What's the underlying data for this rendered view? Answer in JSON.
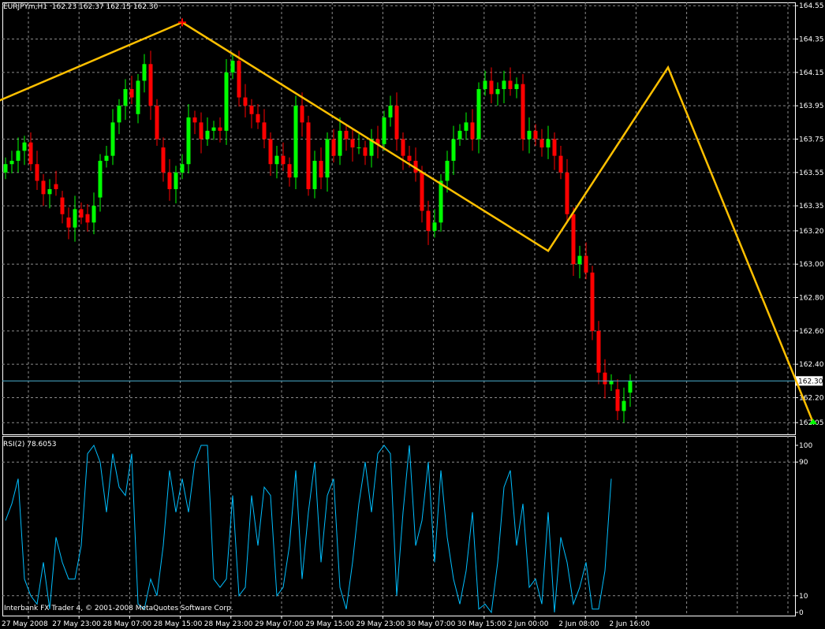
{
  "header": {
    "symbol": "EURJPYm,H1",
    "ohlc": "162.23 162.37 162.15 162.30"
  },
  "footer": "Interbank FX Trader 4, © 2001-2008 MetaQuotes Software Corp.",
  "colors": {
    "background": "#000000",
    "bull": "#00ff00",
    "bear": "#ff0000",
    "grid": "#8c8c8c",
    "zigzag": "#ffc000",
    "rsi": "#00bfff",
    "frame": "#ffffff",
    "price_line": "#4ab0d0"
  },
  "icons": {
    "zigzag_high_marker": "red-cross-icon",
    "zigzag_low_marker": "green-arrow-icon"
  },
  "chart_data": [
    {
      "type": "candlestick",
      "title": "EURJPYm,H1  162.23 162.37 162.15 162.30",
      "ylim": [
        161.98,
        164.57
      ],
      "yticks": [
        "164.55",
        "164.35",
        "164.15",
        "163.95",
        "163.75",
        "163.55",
        "163.35",
        "163.20",
        "163.00",
        "162.80",
        "162.60",
        "162.40",
        "162.20",
        "162.05"
      ],
      "xticks": [
        "27 May 2008",
        "27 May 23:00",
        "28 May 07:00",
        "28 May 15:00",
        "28 May 23:00",
        "29 May 07:00",
        "29 May 15:00",
        "29 May 23:00",
        "30 May 07:00",
        "30 May 15:00",
        "2 Jun 00:00",
        "2 Jun 08:00",
        "2 Jun 16:00"
      ],
      "current_price": "162.30",
      "closes": [
        163.6,
        163.62,
        163.68,
        163.73,
        163.6,
        163.5,
        163.42,
        163.45,
        163.45,
        163.3,
        163.22,
        163.33,
        163.28,
        163.25,
        163.35,
        163.62,
        163.65,
        163.85,
        163.95,
        164.05,
        164.0,
        164.1,
        164.2,
        163.95,
        163.75,
        163.55,
        163.45,
        163.55,
        163.6,
        163.88,
        163.85,
        163.75,
        163.8,
        163.82,
        163.8,
        164.15,
        164.22,
        164.0,
        163.95,
        163.9,
        163.85,
        163.75,
        163.6,
        163.65,
        163.6,
        163.52,
        163.95,
        163.85,
        163.45,
        163.62,
        163.52,
        163.75,
        163.65,
        163.8,
        163.75,
        163.7,
        163.7,
        163.65,
        163.75,
        163.72,
        163.88,
        163.95,
        163.75,
        163.65,
        163.62,
        163.55,
        163.32,
        163.2,
        163.25,
        163.5,
        163.62,
        163.75,
        163.8,
        163.85,
        163.75,
        164.05,
        164.1,
        164.02,
        164.05,
        164.1,
        164.05,
        164.08,
        163.75,
        163.8,
        163.75,
        163.7,
        163.75,
        163.65,
        163.55,
        163.3,
        163.0,
        163.05,
        162.95,
        162.6,
        162.35,
        162.28,
        162.3,
        162.12,
        162.18,
        162.3
      ],
      "opens": [
        163.55,
        163.6,
        163.62,
        163.68,
        163.73,
        163.6,
        163.5,
        163.42,
        163.48,
        163.4,
        163.28,
        163.22,
        163.33,
        163.3,
        163.25,
        163.4,
        163.62,
        163.65,
        163.85,
        163.95,
        164.05,
        163.9,
        164.1,
        164.2,
        163.95,
        163.7,
        163.55,
        163.45,
        163.55,
        163.6,
        163.88,
        163.85,
        163.75,
        163.8,
        163.82,
        163.8,
        164.15,
        164.22,
        164.0,
        163.95,
        163.9,
        163.85,
        163.75,
        163.6,
        163.65,
        163.6,
        163.52,
        163.95,
        163.85,
        163.45,
        163.62,
        163.52,
        163.75,
        163.65,
        163.8,
        163.75,
        163.7,
        163.7,
        163.65,
        163.75,
        163.72,
        163.88,
        163.95,
        163.75,
        163.65,
        163.62,
        163.55,
        163.32,
        163.2,
        163.25,
        163.5,
        163.62,
        163.75,
        163.8,
        163.85,
        163.75,
        164.05,
        164.1,
        164.02,
        164.05,
        164.1,
        164.05,
        164.08,
        163.75,
        163.8,
        163.75,
        163.7,
        163.75,
        163.65,
        163.55,
        163.3,
        163.0,
        163.05,
        162.95,
        162.6,
        162.35,
        162.28,
        162.25,
        162.12,
        162.23
      ],
      "zigzag": [
        {
          "x": -6,
          "y": 163.9
        },
        {
          "x": 28,
          "y": 164.45
        },
        {
          "x": 86,
          "y": 163.08
        },
        {
          "x": 105,
          "y": 164.18
        },
        {
          "x": 128,
          "y": 162.05
        }
      ]
    },
    {
      "type": "line",
      "title": "RSI(2) 78.6053",
      "ylim": [
        0,
        100
      ],
      "yticks": [
        "100",
        "90",
        "10",
        "0"
      ],
      "values": [
        55,
        65,
        80,
        20,
        10,
        5,
        30,
        2,
        45,
        30,
        20,
        20,
        40,
        95,
        100,
        90,
        60,
        95,
        75,
        70,
        95,
        5,
        2,
        20,
        10,
        40,
        85,
        60,
        80,
        60,
        90,
        100,
        100,
        20,
        15,
        20,
        70,
        10,
        15,
        70,
        40,
        75,
        70,
        10,
        15,
        40,
        85,
        20,
        60,
        90,
        30,
        70,
        80,
        15,
        2,
        30,
        65,
        90,
        60,
        95,
        100,
        95,
        10,
        60,
        100,
        40,
        55,
        90,
        30,
        85,
        45,
        20,
        5,
        25,
        60,
        2,
        5,
        0,
        30,
        75,
        85,
        40,
        65,
        15,
        20,
        5,
        60,
        0,
        45,
        30,
        5,
        15,
        30,
        2,
        2,
        25,
        80
      ],
      "series_name": "RSI(2)"
    }
  ]
}
